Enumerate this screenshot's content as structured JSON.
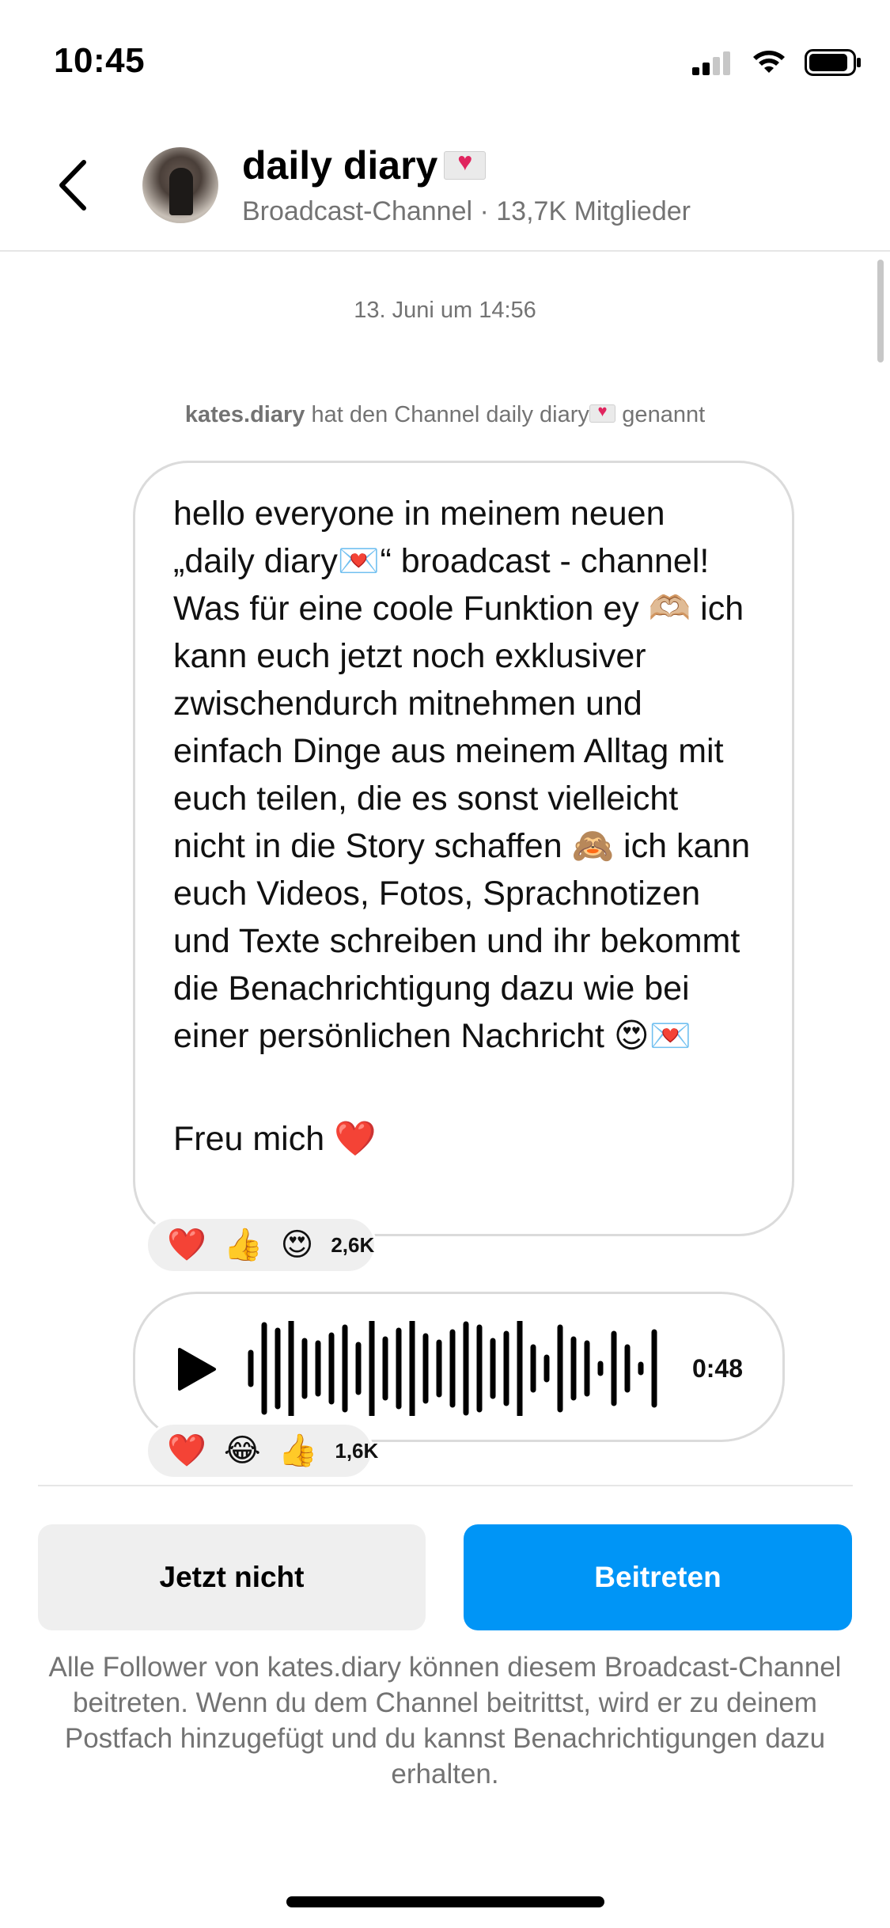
{
  "status_bar": {
    "time": "10:45"
  },
  "header": {
    "title": "daily diary",
    "title_emoji_icon": "love-letter-icon",
    "subtitle": "Broadcast-Channel · 13,7K Mitglieder"
  },
  "chat": {
    "date_stamp": "13. Juni um 14:56",
    "system_message": {
      "user": "kates.diary",
      "text_before": " hat den Channel daily diary",
      "text_after": " genannt"
    },
    "message": {
      "paragraph1": "hello everyone in meinem neuen „daily diary💌“ broadcast - channel! Was für eine coole Funktion ey 🫶🏼 ich kann euch jetzt noch exklusiver zwischendurch mitnehmen und einfach Dinge aus meinem Alltag mit euch teilen, die es sonst vielleicht nicht in die Story schaffen 🙈 ich kann euch Videos, Fotos, Sprachnotizen und Texte schreiben und ihr bekommt die Benachrichtigung dazu wie bei einer persönlichen Nachricht 😍💌",
      "paragraph2": "Freu mich ❤️",
      "reactions": {
        "emojis": [
          "❤️",
          "👍",
          "😍"
        ],
        "count": "2,6K"
      }
    },
    "voice_message": {
      "duration": "0:48",
      "reactions": {
        "emojis": [
          "❤️",
          "😂",
          "👍"
        ],
        "count": "1,6K"
      }
    }
  },
  "actions": {
    "decline_label": "Jetzt nicht",
    "join_label": "Beitreten",
    "notice": "Alle Follower von kates.diary können diesem Broadcast-Channel beitreten. Wenn du dem Channel beitrittst, wird er zu deinem Postfach hinzugefügt und du kannst Benachrichtigungen dazu erhalten."
  },
  "colors": {
    "primary_blue": "#0095f6",
    "secondary_gray": "#efefef",
    "muted_text": "#737373"
  }
}
